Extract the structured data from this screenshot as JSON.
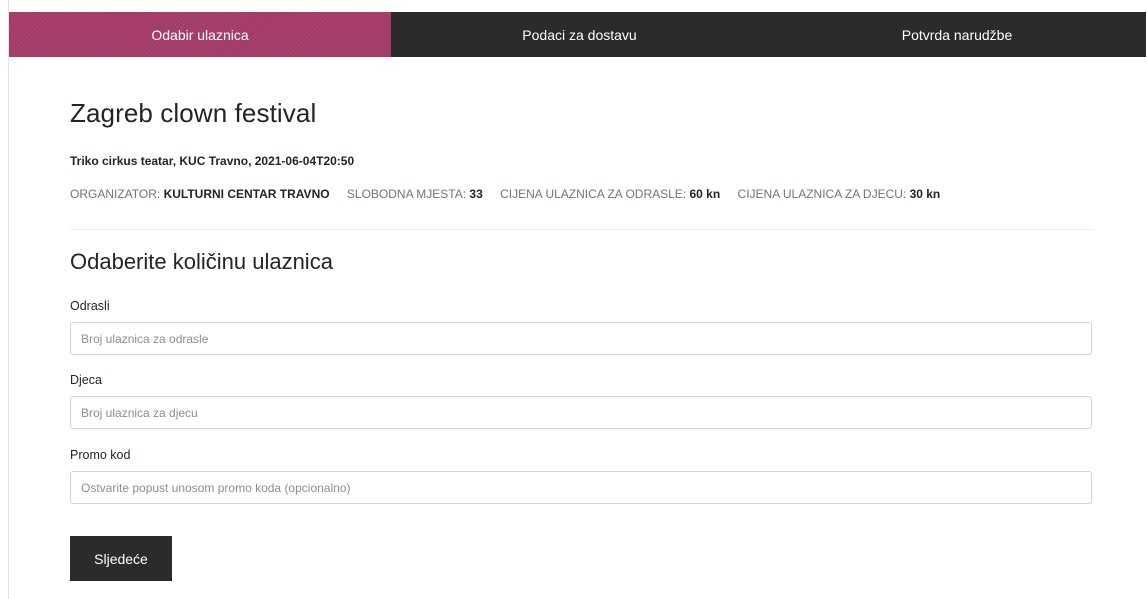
{
  "steps": [
    {
      "label": "Odabir ulaznica",
      "active": true
    },
    {
      "label": "Podaci za dostavu",
      "active": false
    },
    {
      "label": "Potvrda narudžbe",
      "active": false
    }
  ],
  "colors": {
    "accent": "#a33a67",
    "dark": "#2b2b2b"
  },
  "event": {
    "title": "Zagreb clown festival",
    "venue_line": "Triko cirkus teatar, KUC Travno, 2021-06-04T20:50",
    "organizer_label": "ORGANIZATOR:",
    "organizer_value": "KULTURNI CENTAR TRAVNO",
    "free_seats_label": "SLOBODNA MJESTA:",
    "free_seats_value": "33",
    "adult_price_label": "CIJENA ULAZNICA ZA ODRASLE:",
    "adult_price_value": "60 kn",
    "child_price_label": "CIJENA ULAZNICA ZA DJECU:",
    "child_price_value": "30 kn"
  },
  "form": {
    "title": "Odaberite količinu ulaznica",
    "adults": {
      "label": "Odrasli",
      "value": "",
      "placeholder": "Broj ulaznica za odrasle"
    },
    "children": {
      "label": "Djeca",
      "value": "",
      "placeholder": "Broj ulaznica za djecu"
    },
    "promo": {
      "label": "Promo kod",
      "value": "",
      "placeholder": "Ostvarite popust unosom promo koda (opcionalno)"
    },
    "next_label": "Sljedeće"
  }
}
